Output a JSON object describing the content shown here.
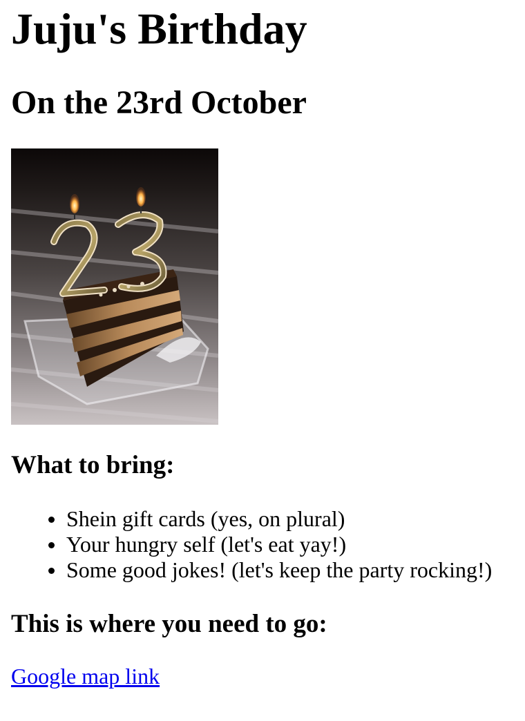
{
  "title": "Juju's Birthday",
  "subtitle": "On the 23rd October",
  "photo": {
    "description_icon": "birthday-cake-photo",
    "candle_number": "23"
  },
  "bring_heading": "What to bring:",
  "bring_items": [
    "Shein gift cards (yes, on plural)",
    "Your hungry self (let's eat yay!)",
    "Some good jokes! (let's keep the party rocking!)"
  ],
  "location_heading": "This is where you need to go:",
  "map_link_label": "Google map link",
  "colors": {
    "link": "#0000ee",
    "text": "#000000",
    "background": "#ffffff"
  }
}
